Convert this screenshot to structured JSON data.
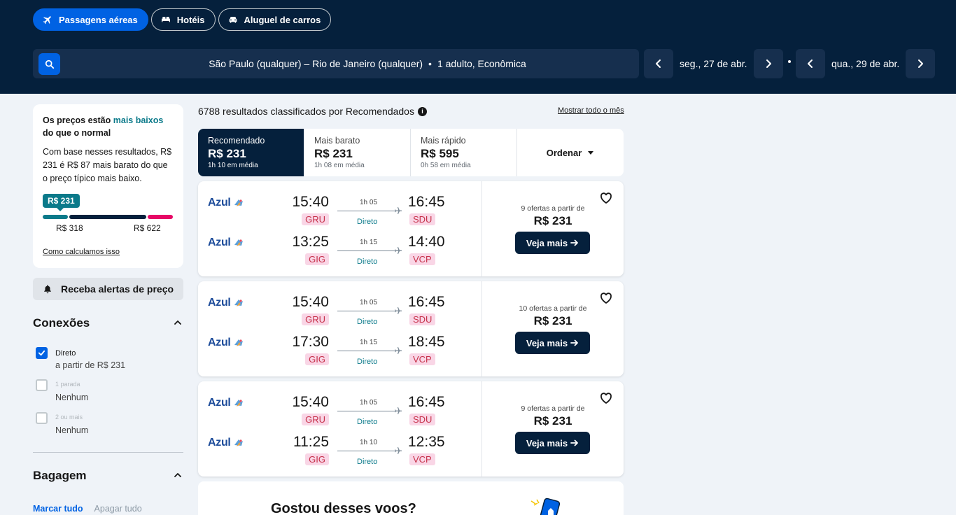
{
  "header": {
    "nav": [
      "Passagens aéreas",
      "Hotéis",
      "Aluguel de carros"
    ],
    "search": {
      "route": "São Paulo (qualquer) – Rio de Janeiro (qualquer)",
      "passengers": "1 adulto, Econômica"
    },
    "depart_date": "seg., 27 de abr.",
    "return_date": "qua., 29 de abr.",
    "colors": {
      "bg": "#05203c",
      "accent": "#0062e3"
    }
  },
  "sidebar": {
    "price_card": {
      "headline_pre": "Os preços estão ",
      "headline_hl": "mais baixos",
      "headline_post": " do que o normal",
      "body": "Com base nesses resultados, R$ 231 é R$ 87 mais barato do que o preço típico mais baixo.",
      "current": "R$ 231",
      "low": "R$ 318",
      "high": "R$ 622",
      "link": "Como calculamos isso"
    },
    "alert_button": "Receba alertas de preço",
    "connections": {
      "title": "Conexões",
      "items": [
        {
          "name": "Direto",
          "sub": "a partir de R$ 231",
          "checked": true
        },
        {
          "name": "1 parada",
          "sub": "Nenhum",
          "checked": false
        },
        {
          "name": "2 ou mais",
          "sub": "Nenhum",
          "checked": false
        }
      ]
    },
    "baggage": {
      "title": "Bagagem",
      "select_all": "Marcar tudo",
      "clear_all": "Apagar tudo"
    }
  },
  "results": {
    "count_text": "6788 resultados classificados por Recomendados",
    "month_link": "Mostrar todo o mês",
    "tabs": [
      {
        "label": "Recomendado",
        "price": "R$ 231",
        "sub": "1h 10 em média"
      },
      {
        "label": "Mais barato",
        "price": "R$ 231",
        "sub": "1h 08 em média"
      },
      {
        "label": "Mais rápido",
        "price": "R$ 595",
        "sub": "0h 58 em média"
      }
    ],
    "sort_label": "Ordenar",
    "cards": [
      {
        "legs": [
          {
            "airline": "Azul",
            "dep": "15:40",
            "dep_code": "GRU",
            "arr": "16:45",
            "arr_code": "SDU",
            "duration": "1h 05",
            "stops": "Direto"
          },
          {
            "airline": "Azul",
            "dep": "13:25",
            "dep_code": "GIG",
            "arr": "14:40",
            "arr_code": "VCP",
            "duration": "1h 15",
            "stops": "Direto"
          }
        ],
        "offers": "9 ofertas a partir de",
        "price": "R$ 231",
        "cta": "Veja mais"
      },
      {
        "legs": [
          {
            "airline": "Azul",
            "dep": "15:40",
            "dep_code": "GRU",
            "arr": "16:45",
            "arr_code": "SDU",
            "duration": "1h 05",
            "stops": "Direto"
          },
          {
            "airline": "Azul",
            "dep": "17:30",
            "dep_code": "GIG",
            "arr": "18:45",
            "arr_code": "VCP",
            "duration": "1h 15",
            "stops": "Direto"
          }
        ],
        "offers": "10 ofertas a partir de",
        "price": "R$ 231",
        "cta": "Veja mais"
      },
      {
        "legs": [
          {
            "airline": "Azul",
            "dep": "15:40",
            "dep_code": "GRU",
            "arr": "16:45",
            "arr_code": "SDU",
            "duration": "1h 05",
            "stops": "Direto"
          },
          {
            "airline": "Azul",
            "dep": "11:25",
            "dep_code": "GIG",
            "arr": "12:35",
            "arr_code": "VCP",
            "duration": "1h 10",
            "stops": "Direto"
          }
        ],
        "offers": "9 ofertas a partir de",
        "price": "R$ 231",
        "cta": "Veja mais"
      }
    ],
    "promo_title": "Gostou desses voos?"
  }
}
